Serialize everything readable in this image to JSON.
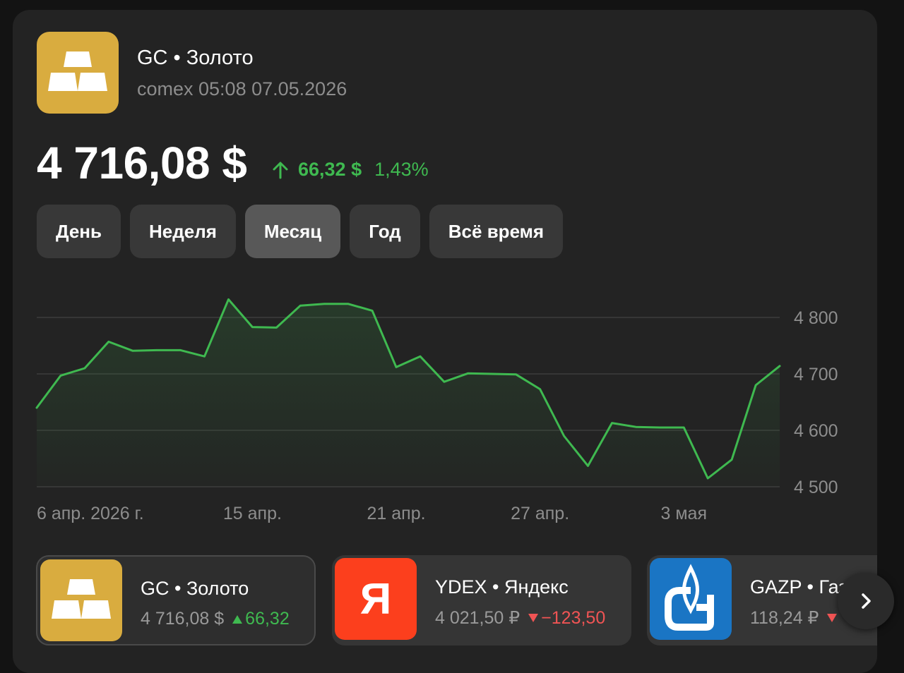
{
  "instrument": {
    "title": "GC • Золото",
    "subtitle": "comex 05:08 07.05.2026",
    "price": "4 716,08 $",
    "change_abs": "66,32 $",
    "change_pct": "1,43%",
    "icon": "gold-bars-icon"
  },
  "periods": [
    {
      "label": "День",
      "active": false
    },
    {
      "label": "Неделя",
      "active": false
    },
    {
      "label": "Месяц",
      "active": true
    },
    {
      "label": "Год",
      "active": false
    },
    {
      "label": "Всё время",
      "active": false
    }
  ],
  "chart_data": {
    "type": "area",
    "x_tick_labels": [
      "6 апр. 2026 г.",
      "15 апр.",
      "21 апр.",
      "27 апр.",
      "3 мая"
    ],
    "y_tick_labels": [
      "4 800",
      "4 700",
      "4 600",
      "4 500"
    ],
    "y_ticks": [
      4800,
      4700,
      4600,
      4500
    ],
    "ylim": [
      4490,
      4850
    ],
    "grid": true,
    "values": [
      4640,
      4697,
      4710,
      4757,
      4741,
      4742,
      4742,
      4731,
      4832,
      4783,
      4782,
      4821,
      4824,
      4824,
      4812,
      4712,
      4731,
      4686,
      4701,
      4700,
      4699,
      4673,
      4590,
      4537,
      4613,
      4606,
      4605,
      4605,
      4515,
      4548,
      4680,
      4714
    ],
    "x_tick_positions": [
      0,
      9,
      15,
      21,
      27
    ],
    "line_color": "#3fb950"
  },
  "tickers": [
    {
      "name": "GC • Золото",
      "price": "4 716,08 $",
      "change": "66,32",
      "direction": "up",
      "icon": "gold-bars-icon"
    },
    {
      "name": "YDEX • Яндекс",
      "price": "4 021,50 ₽",
      "change": "−123,50",
      "direction": "down",
      "icon": "yandex-logo-icon",
      "logo_letter": "Я"
    },
    {
      "name": "GAZP • Газпром",
      "price": "118,24 ₽",
      "change": "",
      "direction": "down",
      "icon": "gazprom-logo-icon"
    }
  ],
  "colors": {
    "up": "#3fb950",
    "down": "#f05454",
    "gold": "#d9ac3f",
    "yandex": "#fc3f1d",
    "gazprom": "#1a75c4"
  }
}
